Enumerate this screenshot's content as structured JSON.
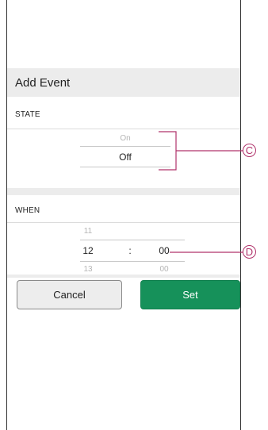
{
  "header": {
    "title": "Add Event"
  },
  "state_section": {
    "label": "STATE",
    "options": {
      "above": "On",
      "selected": "Off"
    }
  },
  "when_section": {
    "label": "WHEN",
    "hour": {
      "above": "11",
      "selected": "12",
      "below": "13"
    },
    "separator": ":",
    "minute": {
      "above": "",
      "selected": "00",
      "below": "00"
    }
  },
  "buttons": {
    "cancel_label": "Cancel",
    "set_label": "Set"
  },
  "callouts": {
    "state_picker": "C",
    "time_picker": "D"
  },
  "colors": {
    "accent": "#16915a",
    "callout": "#b0336b",
    "section_bg": "#ececec"
  }
}
